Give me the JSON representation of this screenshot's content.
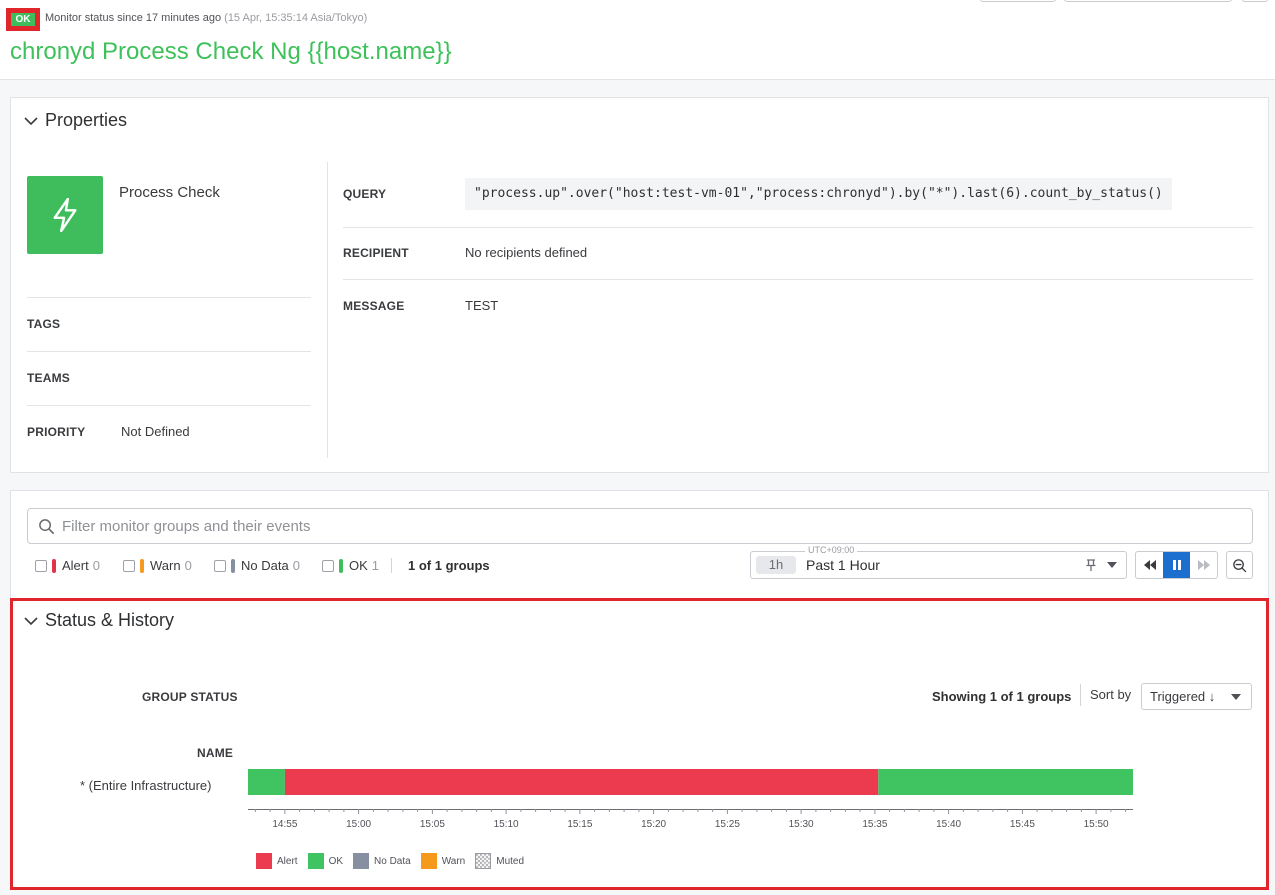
{
  "header": {
    "status_badge": "OK",
    "since_text": "Monitor status since 17 minutes ago",
    "since_timestamp": "(15 Apr, 15:35:14 Asia/Tokyo)",
    "title": "chronyd Process Check Ng {{host.name}}"
  },
  "properties": {
    "section_title": "Properties",
    "monitor_type": "Process Check",
    "left_rows": [
      {
        "key": "TAGS",
        "value": ""
      },
      {
        "key": "TEAMS",
        "value": ""
      },
      {
        "key": "PRIORITY",
        "value": "Not Defined"
      }
    ],
    "query_label": "QUERY",
    "query_value": "\"process.up\".over(\"host:test-vm-01\",\"process:chronyd\").by(\"*\").last(6).count_by_status()",
    "recipient_label": "RECIPIENT",
    "recipient_value": "No recipients defined",
    "message_label": "MESSAGE",
    "message_value": "TEST"
  },
  "filter": {
    "search_placeholder": "Filter monitor groups and their events",
    "checkboxes": [
      {
        "label": "Alert",
        "count": "0",
        "color": "#e0334a"
      },
      {
        "label": "Warn",
        "count": "0",
        "color": "#f59a1c"
      },
      {
        "label": "No Data",
        "count": "0",
        "color": "#8790a0"
      },
      {
        "label": "OK",
        "count": "1",
        "color": "#3fbd5c"
      }
    ],
    "groups_count": "1 of 1 groups",
    "timezone": "UTC+09:00",
    "time_pill": "1h",
    "time_label": "Past 1 Hour"
  },
  "status_history": {
    "section_title": "Status & History",
    "group_status_label": "GROUP STATUS",
    "showing_text": "Showing 1 of 1 groups",
    "sort_by_label": "Sort by",
    "sort_value": "Triggered ↓",
    "name_header": "NAME",
    "row_label": "* (Entire Infrastructure)",
    "axis_ticks": [
      "14:55",
      "15:00",
      "15:05",
      "15:10",
      "15:15",
      "15:20",
      "15:25",
      "15:30",
      "15:35",
      "15:40",
      "15:45",
      "15:50"
    ],
    "legend": [
      {
        "label": "Alert",
        "color": "#ec3a4e"
      },
      {
        "label": "OK",
        "color": "#40c462"
      },
      {
        "label": "No Data",
        "color": "#8790a0"
      },
      {
        "label": "Warn",
        "color": "#f59a1c"
      },
      {
        "label": "Muted",
        "color": "hatched"
      }
    ]
  },
  "chart_data": {
    "type": "bar",
    "x_axis": {
      "range": [
        "14:52:30",
        "15:52:30"
      ],
      "ticks": [
        "14:55",
        "15:00",
        "15:05",
        "15:10",
        "15:15",
        "15:20",
        "15:25",
        "15:30",
        "15:35",
        "15:40",
        "15:45",
        "15:50"
      ]
    },
    "series": [
      {
        "name": "* (Entire Infrastructure)",
        "segments": [
          {
            "status": "OK",
            "start": "14:52:30",
            "end": "14:55:00",
            "color": "#40c462"
          },
          {
            "status": "Alert",
            "start": "14:55:00",
            "end": "15:35:14",
            "color": "#ec3a4e"
          },
          {
            "status": "OK",
            "start": "15:35:14",
            "end": "15:52:30",
            "color": "#40c462"
          }
        ]
      }
    ]
  }
}
